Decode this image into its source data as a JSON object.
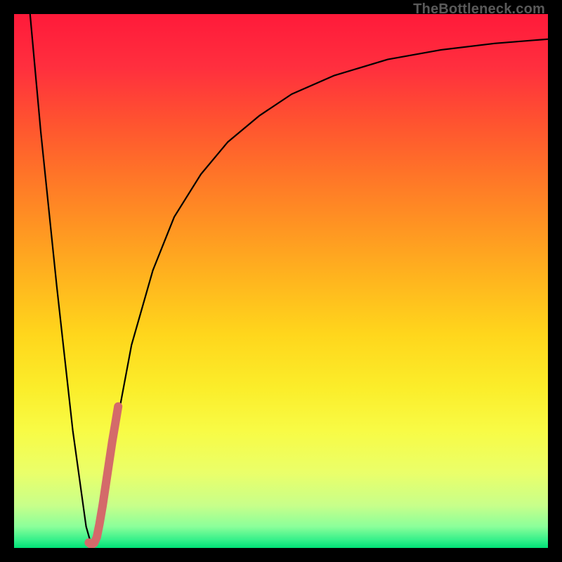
{
  "watermark": "TheBottleneck.com",
  "gradient": {
    "stops": [
      {
        "offset": 0.0,
        "color": "#ff1a3a"
      },
      {
        "offset": 0.1,
        "color": "#ff2f3e"
      },
      {
        "offset": 0.2,
        "color": "#ff5230"
      },
      {
        "offset": 0.3,
        "color": "#ff7428"
      },
      {
        "offset": 0.4,
        "color": "#ff9522"
      },
      {
        "offset": 0.5,
        "color": "#ffb61e"
      },
      {
        "offset": 0.6,
        "color": "#ffd61c"
      },
      {
        "offset": 0.7,
        "color": "#fbed2a"
      },
      {
        "offset": 0.78,
        "color": "#f8fb45"
      },
      {
        "offset": 0.86,
        "color": "#eaff6a"
      },
      {
        "offset": 0.92,
        "color": "#c8ff8a"
      },
      {
        "offset": 0.96,
        "color": "#8bff9a"
      },
      {
        "offset": 0.985,
        "color": "#35f08a"
      },
      {
        "offset": 1.0,
        "color": "#00e176"
      }
    ]
  },
  "chart_data": {
    "type": "line",
    "title": "",
    "xlabel": "",
    "ylabel": "",
    "xlim": [
      0,
      100
    ],
    "ylim": [
      0,
      100
    ],
    "grid": false,
    "series": [
      {
        "name": "main-curve",
        "color": "#000000",
        "width": 2.2,
        "x": [
          3,
          5,
          8,
          11,
          13.5,
          14.5,
          15.5,
          17,
          19,
          22,
          26,
          30,
          35,
          40,
          46,
          52,
          60,
          70,
          80,
          90,
          100
        ],
        "y": [
          100,
          78,
          49,
          22,
          4,
          0.5,
          2,
          10,
          22,
          38,
          52,
          62,
          70,
          76,
          81,
          85,
          88.5,
          91.5,
          93.3,
          94.5,
          95.3
        ]
      },
      {
        "name": "highlight-segment",
        "color": "#d46a6a",
        "width": 12,
        "linecap": "round",
        "x": [
          14.0,
          14.5,
          15.0,
          15.5,
          16.0,
          16.6,
          17.2,
          17.8,
          18.4,
          19.0,
          19.5
        ],
        "y": [
          1.0,
          0.6,
          0.9,
          2.0,
          4.5,
          8.0,
          12.0,
          16.0,
          20.0,
          23.5,
          26.5
        ]
      }
    ]
  }
}
